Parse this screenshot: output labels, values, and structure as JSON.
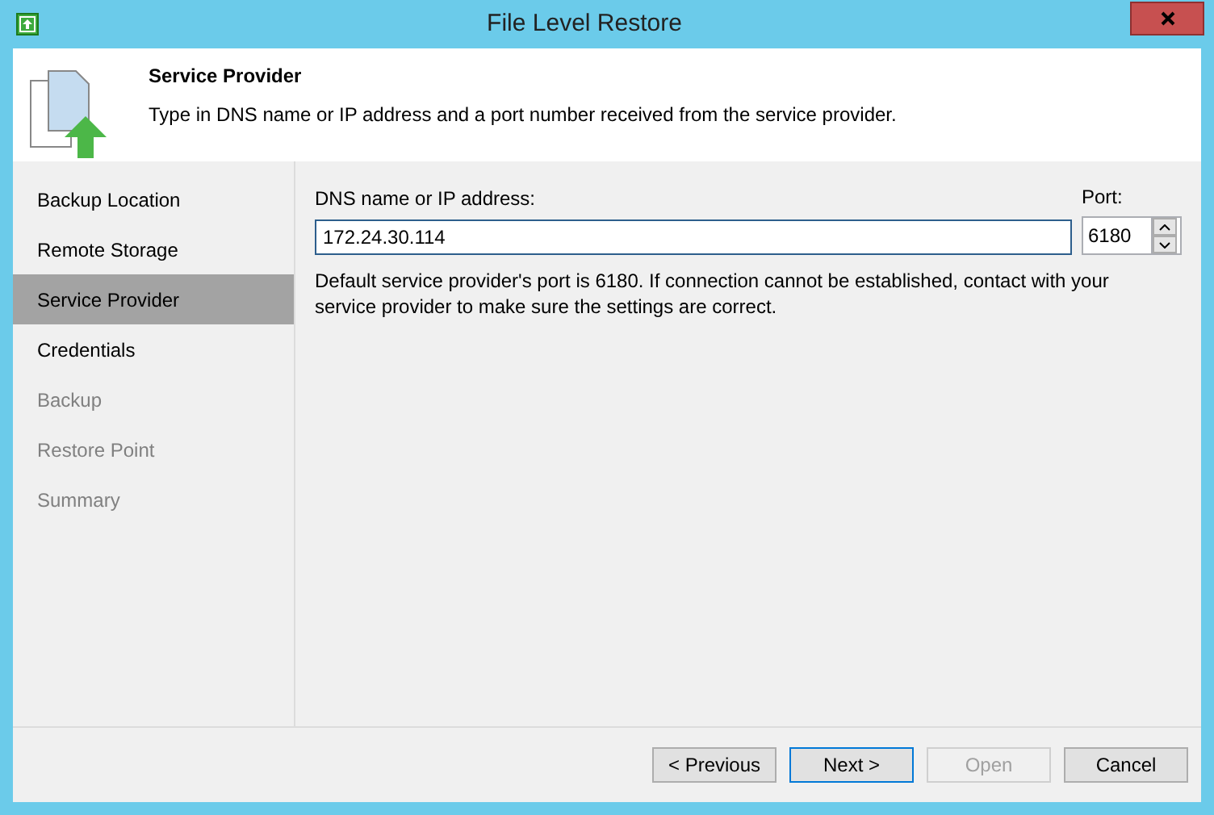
{
  "window": {
    "title": "File Level Restore"
  },
  "header": {
    "title": "Service Provider",
    "description": "Type in DNS name or IP address and a port number received from the service provider."
  },
  "steps": [
    {
      "label": "Backup Location",
      "selected": false,
      "disabled": false
    },
    {
      "label": "Remote Storage",
      "selected": false,
      "disabled": false
    },
    {
      "label": "Service Provider",
      "selected": true,
      "disabled": false
    },
    {
      "label": "Credentials",
      "selected": false,
      "disabled": false
    },
    {
      "label": "Backup",
      "selected": false,
      "disabled": true
    },
    {
      "label": "Restore Point",
      "selected": false,
      "disabled": true
    },
    {
      "label": "Summary",
      "selected": false,
      "disabled": true
    }
  ],
  "dns": {
    "label": "DNS name or IP address:",
    "value": "172.24.30.114"
  },
  "port": {
    "label": "Port:",
    "value": "6180"
  },
  "note": "Default service provider's port is 6180. If connection cannot be established, contact with your service provider to make sure the settings are correct.",
  "buttons": [
    {
      "label": "< Previous",
      "default": false,
      "disabled": false
    },
    {
      "label": "Next >",
      "default": true,
      "disabled": false
    },
    {
      "label": "Open",
      "default": false,
      "disabled": true
    },
    {
      "label": "Cancel",
      "default": false,
      "disabled": false
    }
  ]
}
